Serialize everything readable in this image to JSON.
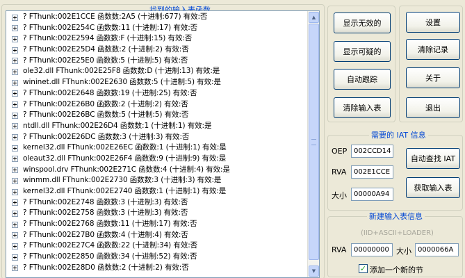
{
  "import_table": {
    "title": "找到的输入表函数",
    "rows": [
      "? FThunk:002E1CCE 函数数:2A5 (十进制:677) 有效:否",
      "? FThunk:002E254C 函数数:11 (十进制:17) 有效:否",
      "? FThunk:002E2594 函数数:F (十进制:15) 有效:否",
      "? FThunk:002E25D4 函数数:2 (十进制:2) 有效:否",
      "? FThunk:002E25E0 函数数:5 (十进制:5) 有效:否",
      "ole32.dll FThunk:002E25F8 函数数:D (十进制:13) 有效:是",
      "wininet.dll FThunk:002E2630 函数数:5 (十进制:5) 有效:是",
      "? FThunk:002E2648 函数数:19 (十进制:25) 有效:否",
      "? FThunk:002E26B0 函数数:2 (十进制:2) 有效:否",
      "? FThunk:002E26BC 函数数:5 (十进制:5) 有效:否",
      "ntdll.dll FThunk:002E26D4 函数数:1 (十进制:1) 有效:是",
      "? FThunk:002E26DC 函数数:3 (十进制:3) 有效:否",
      "kernel32.dll FThunk:002E26EC 函数数:1 (十进制:1) 有效:是",
      "oleaut32.dll FThunk:002E26F4 函数数:9 (十进制:9) 有效:是",
      "winspool.drv FThunk:002E271C 函数数:4 (十进制:4) 有效:是",
      "winmm.dll FThunk:002E2730 函数数:3 (十进制:3) 有效:是",
      "kernel32.dll FThunk:002E2740 函数数:1 (十进制:1) 有效:是",
      "? FThunk:002E2748 函数数:3 (十进制:3) 有效:否",
      "? FThunk:002E2758 函数数:3 (十进制:3) 有效:否",
      "? FThunk:002E2768 函数数:11 (十进制:17) 有效:否",
      "? FThunk:002E27B0 函数数:4 (十进制:4) 有效:否",
      "? FThunk:002E27C4 函数数:22 (十进制:34) 有效:否",
      "? FThunk:002E2850 函数数:34 (十进制:52) 有效:否",
      "? FThunk:002E28D0 函数数:2 (十进制:2) 有效:否"
    ]
  },
  "buttons": {
    "show_invalid": "显示无效的",
    "show_suspect": "显示可疑的",
    "auto_trace": "自动跟踪",
    "clear_import": "清除输入表",
    "settings": "设置",
    "clear_log": "清除记录",
    "about": "关于",
    "exit": "退出"
  },
  "iat": {
    "title": "需要的 IAT 信息",
    "oep_label": "OEP",
    "oep_value": "002CCD14",
    "rva_label": "RVA",
    "rva_value": "002E1CCE",
    "size_label": "大小",
    "size_value": "00000A94",
    "auto_find": "自动查找 IAT",
    "get_import": "获取输入表"
  },
  "new_import": {
    "title": "新建输入表信息",
    "hint": "(IID+ASCII+LOADER)",
    "rva_label": "RVA",
    "rva_value": "00000000",
    "size_label": "大小",
    "size_value": "0000066A",
    "checkbox_label": "添加一个新的节",
    "checkbox_checked": true
  }
}
